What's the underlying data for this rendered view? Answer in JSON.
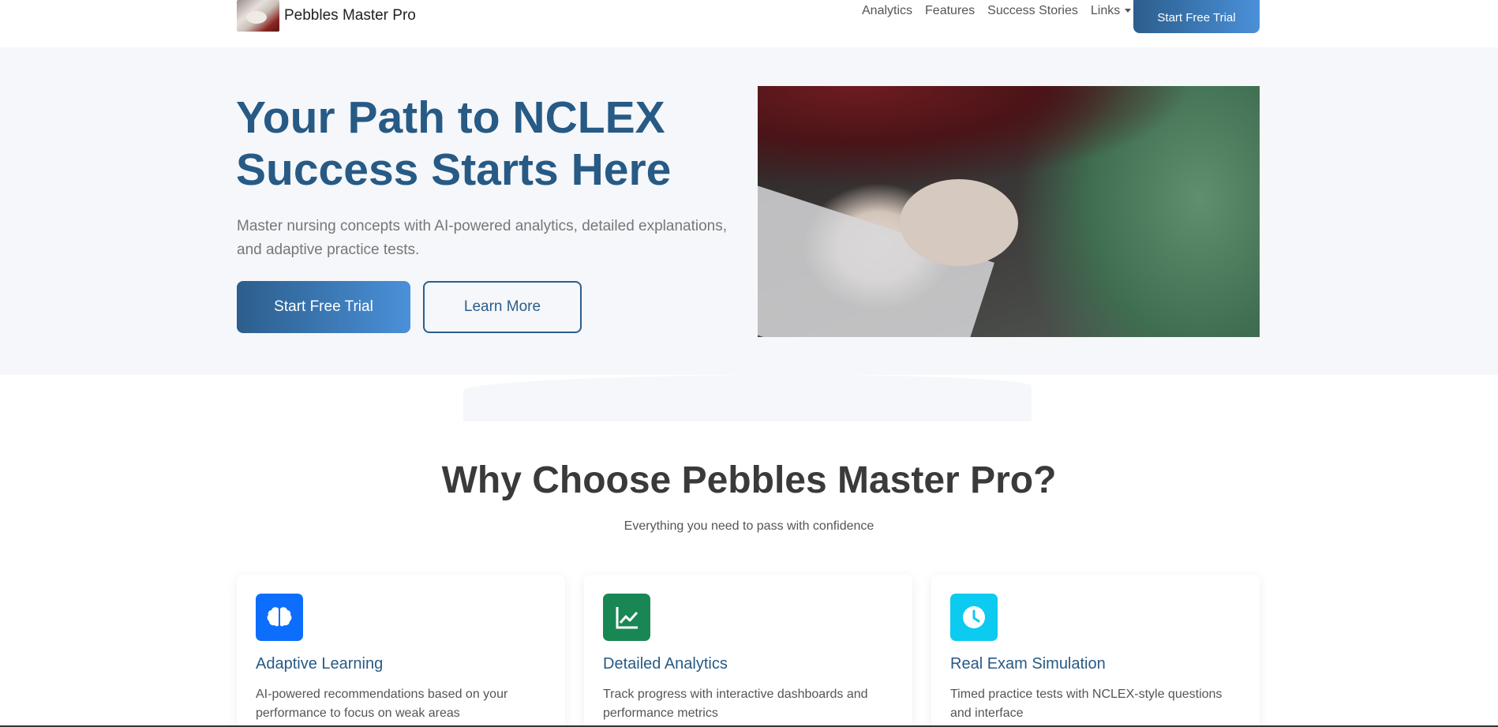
{
  "nav": {
    "brand": "Pebbles Master Pro",
    "links": [
      "Analytics",
      "Features",
      "Success Stories",
      "Links"
    ],
    "cta": "Start Free Trial"
  },
  "hero": {
    "title": "Your Path to NCLEX Success Starts Here",
    "subtitle": "Master nursing concepts with AI-powered analytics, detailed explanations, and adaptive practice tests.",
    "primary_button": "Start Free Trial",
    "secondary_button": "Learn More"
  },
  "features": {
    "title": "Why Choose Pebbles Master Pro?",
    "subtitle": "Everything you need to pass with confidence",
    "cards": [
      {
        "icon": "brain-icon",
        "color": "#0d6efd",
        "title": "Adaptive Learning",
        "text": "AI-powered recommendations based on your performance to focus on weak areas"
      },
      {
        "icon": "chart-line-icon",
        "color": "#198754",
        "title": "Detailed Analytics",
        "text": "Track progress with interactive dashboards and performance metrics"
      },
      {
        "icon": "clock-icon",
        "color": "#0dcaf0",
        "title": "Real Exam Simulation",
        "text": "Timed practice tests with NCLEX-style questions and interface"
      }
    ]
  },
  "colors": {
    "primary": "#275a85",
    "gradient_start": "#2c5e8c",
    "gradient_end": "#4a90d9",
    "hero_bg": "#f5f7fa"
  }
}
